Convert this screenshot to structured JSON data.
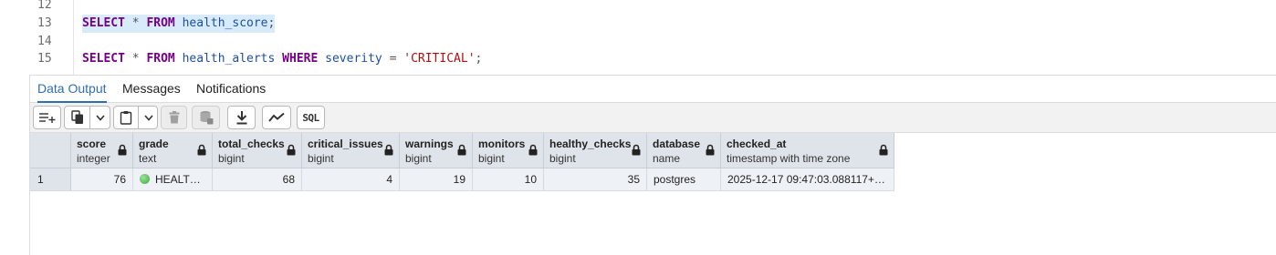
{
  "editor": {
    "line_numbers": [
      "12",
      "13",
      "14",
      "15"
    ],
    "line13": {
      "kw_select": "SELECT",
      "star": " * ",
      "kw_from": "FROM",
      "table": "health_score",
      "end": ";"
    },
    "line15": {
      "kw_select": "SELECT",
      "star": " * ",
      "kw_from": "FROM",
      "table": "health_alerts",
      "kw_where": "WHERE",
      "column": "severity",
      "eq": " = ",
      "value": "'CRITICAL'",
      "end": ";"
    }
  },
  "tabs": [
    {
      "label": "Data Output",
      "active": true
    },
    {
      "label": "Messages",
      "active": false
    },
    {
      "label": "Notifications",
      "active": false
    }
  ],
  "toolbar": {
    "icons": [
      "add-row-icon",
      "copy-icon",
      "chevron-down-icon",
      "paste-icon",
      "chevron-down-icon",
      "delete-icon",
      "save-data-icon",
      "download-icon",
      "graph-icon",
      "sql-icon"
    ],
    "sql_label": "SQL"
  },
  "grid": {
    "columns": [
      {
        "name": "score",
        "type": "integer"
      },
      {
        "name": "grade",
        "type": "text"
      },
      {
        "name": "total_checks",
        "type": "bigint"
      },
      {
        "name": "critical_issues",
        "type": "bigint"
      },
      {
        "name": "warnings",
        "type": "bigint"
      },
      {
        "name": "monitors",
        "type": "bigint"
      },
      {
        "name": "healthy_checks",
        "type": "bigint"
      },
      {
        "name": "database",
        "type": "name"
      },
      {
        "name": "checked_at",
        "type": "timestamp with time zone"
      }
    ],
    "rows": [
      {
        "row_number": "1",
        "cells": [
          "76",
          "HEALT…",
          "68",
          "4",
          "19",
          "10",
          "35",
          "postgres",
          "2025-12-17 09:47:03.088117+…"
        ]
      }
    ]
  },
  "colors": {
    "accent": "#2f6fb0",
    "keyword": "#770088",
    "identifier": "#1e4f9e",
    "string": "#aa1111",
    "selection": "#d8ebfb",
    "grade_dot": "#3caa3c"
  }
}
